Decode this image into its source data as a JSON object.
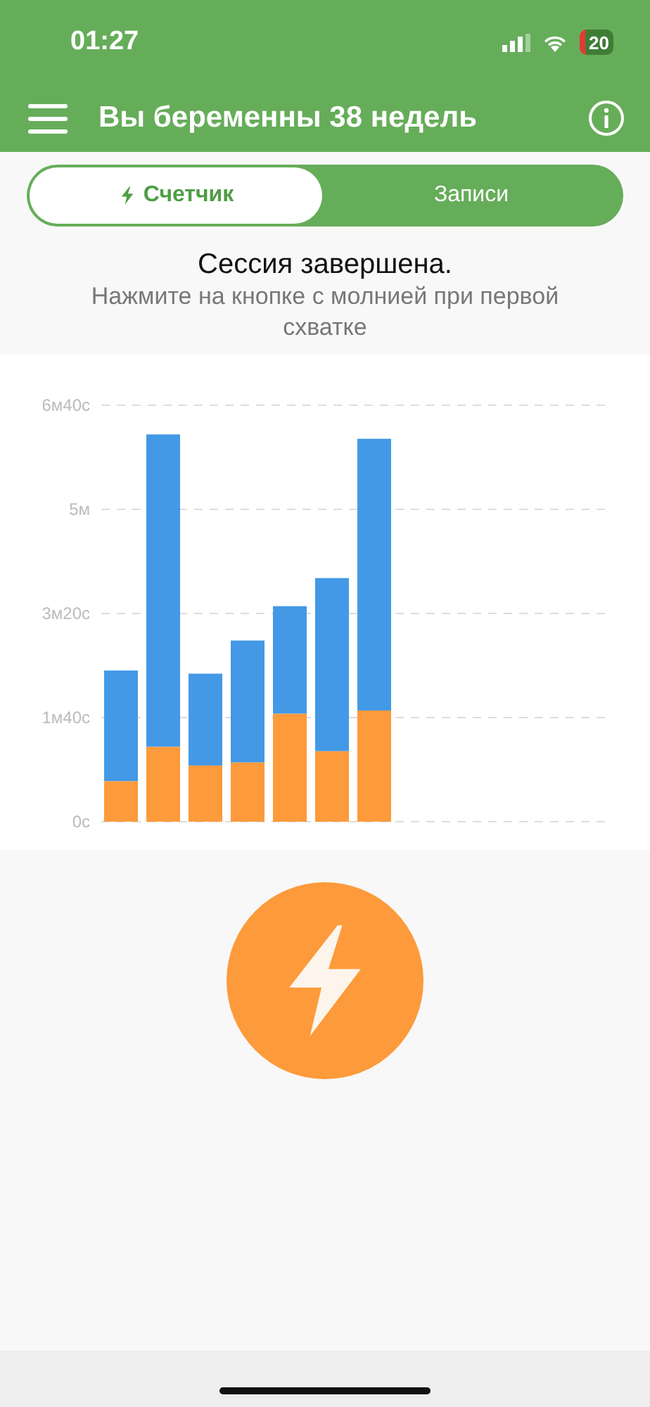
{
  "status_bar": {
    "time": "01:27",
    "battery": "20"
  },
  "header": {
    "title": "Вы беременны 38 недель"
  },
  "tabs": [
    {
      "label": "Счетчик",
      "selected": true
    },
    {
      "label": "Записи",
      "selected": false
    }
  ],
  "message": {
    "title": "Сессия завершена.",
    "hint": "Нажмите на кнопке с молнией при первой схватке"
  },
  "chart": {
    "chart_data": {
      "type": "bar",
      "stacked": true,
      "grid": true,
      "ylim": [
        0,
        6.667
      ],
      "yticks": [
        {
          "value": 0,
          "label": "0с"
        },
        {
          "value": 1.667,
          "label": "1м40с"
        },
        {
          "value": 3.333,
          "label": "3м20с"
        },
        {
          "value": 5,
          "label": "5м"
        },
        {
          "value": 6.667,
          "label": "6м40с"
        }
      ],
      "series": [
        {
          "color": "#fd9a3b",
          "values": [
            0.65,
            1.2,
            0.9,
            0.95,
            1.73,
            1.13,
            1.78
          ]
        },
        {
          "color": "#4399e6",
          "values": [
            1.77,
            5,
            1.47,
            1.95,
            1.72,
            2.77,
            4.35
          ]
        }
      ]
    }
  }
}
